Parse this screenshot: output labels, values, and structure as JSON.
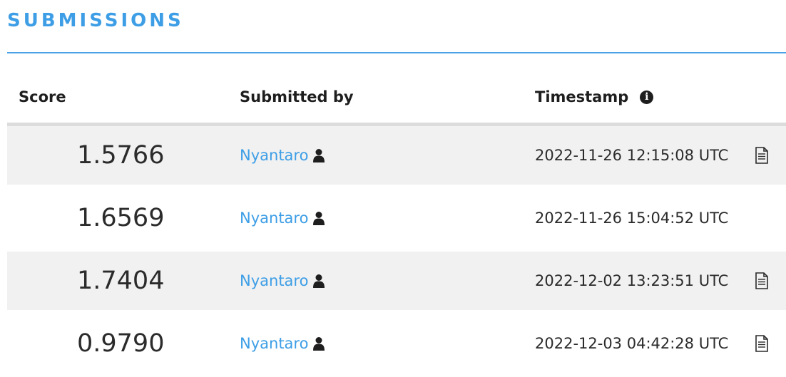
{
  "section": {
    "title": "SUBMISSIONS"
  },
  "table": {
    "headers": {
      "score": "Score",
      "submitted_by": "Submitted by",
      "timestamp": "Timestamp"
    },
    "rows": [
      {
        "score": "1.5766",
        "user": "Nyantaro",
        "timestamp": "2022-11-26 12:15:08 UTC",
        "has_file": true
      },
      {
        "score": "1.6569",
        "user": "Nyantaro",
        "timestamp": "2022-11-26 15:04:52 UTC",
        "has_file": false
      },
      {
        "score": "1.7404",
        "user": "Nyantaro",
        "timestamp": "2022-12-02 13:23:51 UTC",
        "has_file": true
      },
      {
        "score": "0.9790",
        "user": "Nyantaro",
        "timestamp": "2022-12-03 04:42:28 UTC",
        "has_file": true
      }
    ]
  },
  "icons": {
    "timestamp_help": "info-icon",
    "user": "person-icon",
    "file": "document-icon"
  },
  "colors": {
    "accent": "#3d9ee6",
    "row_alt": "#f1f1f1",
    "text": "#2b2b2b"
  }
}
